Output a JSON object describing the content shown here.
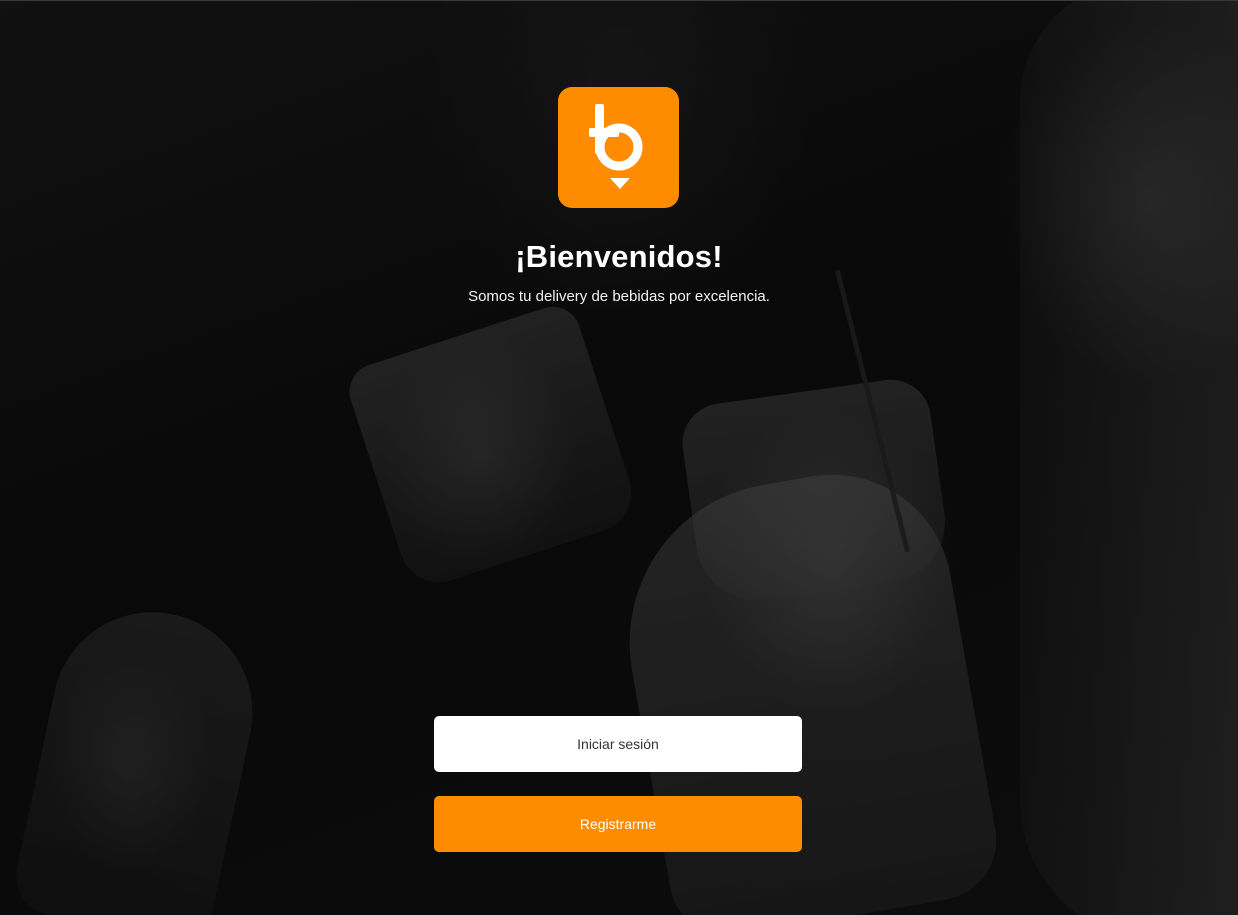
{
  "welcome": {
    "title": "¡Bienvenidos!",
    "subtitle": "Somos tu delivery de bebidas por excelencia."
  },
  "logo": {
    "icon": "b-pin-logo-icon",
    "background_color": "#ff8c00"
  },
  "actions": {
    "login_label": "Iniciar sesión",
    "register_label": "Registrarme"
  },
  "colors": {
    "accent": "#ff8c00",
    "login_bg": "#ffffff",
    "text_light": "#ffffff"
  }
}
